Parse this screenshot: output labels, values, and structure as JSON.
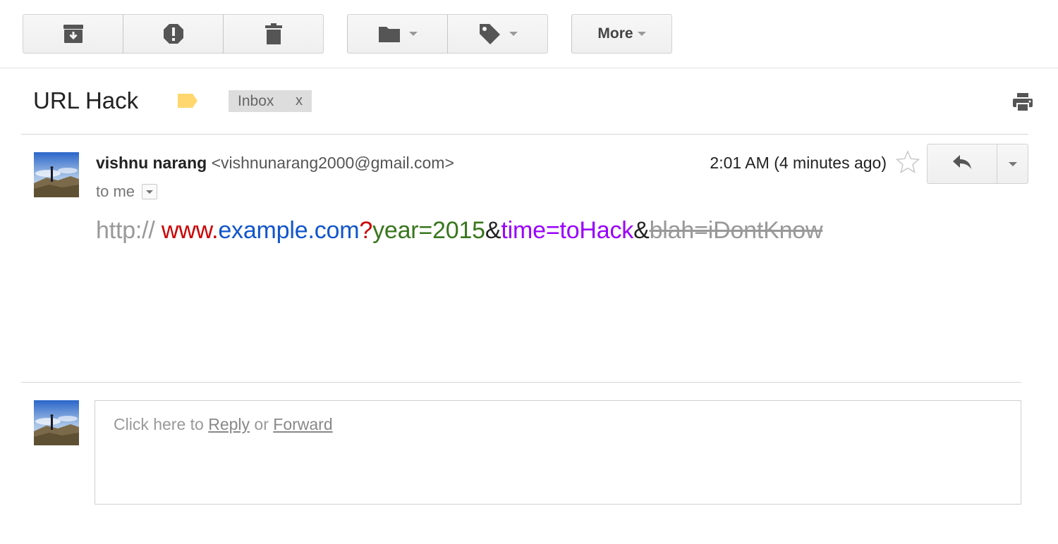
{
  "toolbar": {
    "archive_icon": "archive-icon",
    "spam_icon": "report-spam-icon",
    "delete_icon": "trash-icon",
    "move_icon": "folder-icon",
    "labels_icon": "tag-icon",
    "more_label": "More"
  },
  "subject": {
    "title": "URL Hack",
    "label_chip": "Inbox",
    "label_remove": "x"
  },
  "message": {
    "sender_name": "vishnu narang",
    "sender_email": "<vishnunarang2000@gmail.com>",
    "to": "to me",
    "time": "2:01 AM (4 minutes ago)",
    "body_url": {
      "scheme": "http://",
      "subdomain": "www.",
      "domain": "example.com",
      "query_mark": "?",
      "param1": "year=2015",
      "amp1": "&",
      "param2": "time=toHack",
      "amp2": "&",
      "param3": "blah=iDontKnow"
    }
  },
  "reply_box": {
    "prefix": "Click here to",
    "reply": "Reply",
    "or": "or",
    "forward": "Forward"
  },
  "colors": {
    "url_scheme": "#999999",
    "url_subdomain": "#cc0000",
    "url_domain": "#1155cc",
    "url_query_mark": "#cc0000",
    "url_param1": "#38761d",
    "url_param2": "#9900ff",
    "url_param3_struck": "#999999",
    "label_tag": "#ffd76e"
  }
}
